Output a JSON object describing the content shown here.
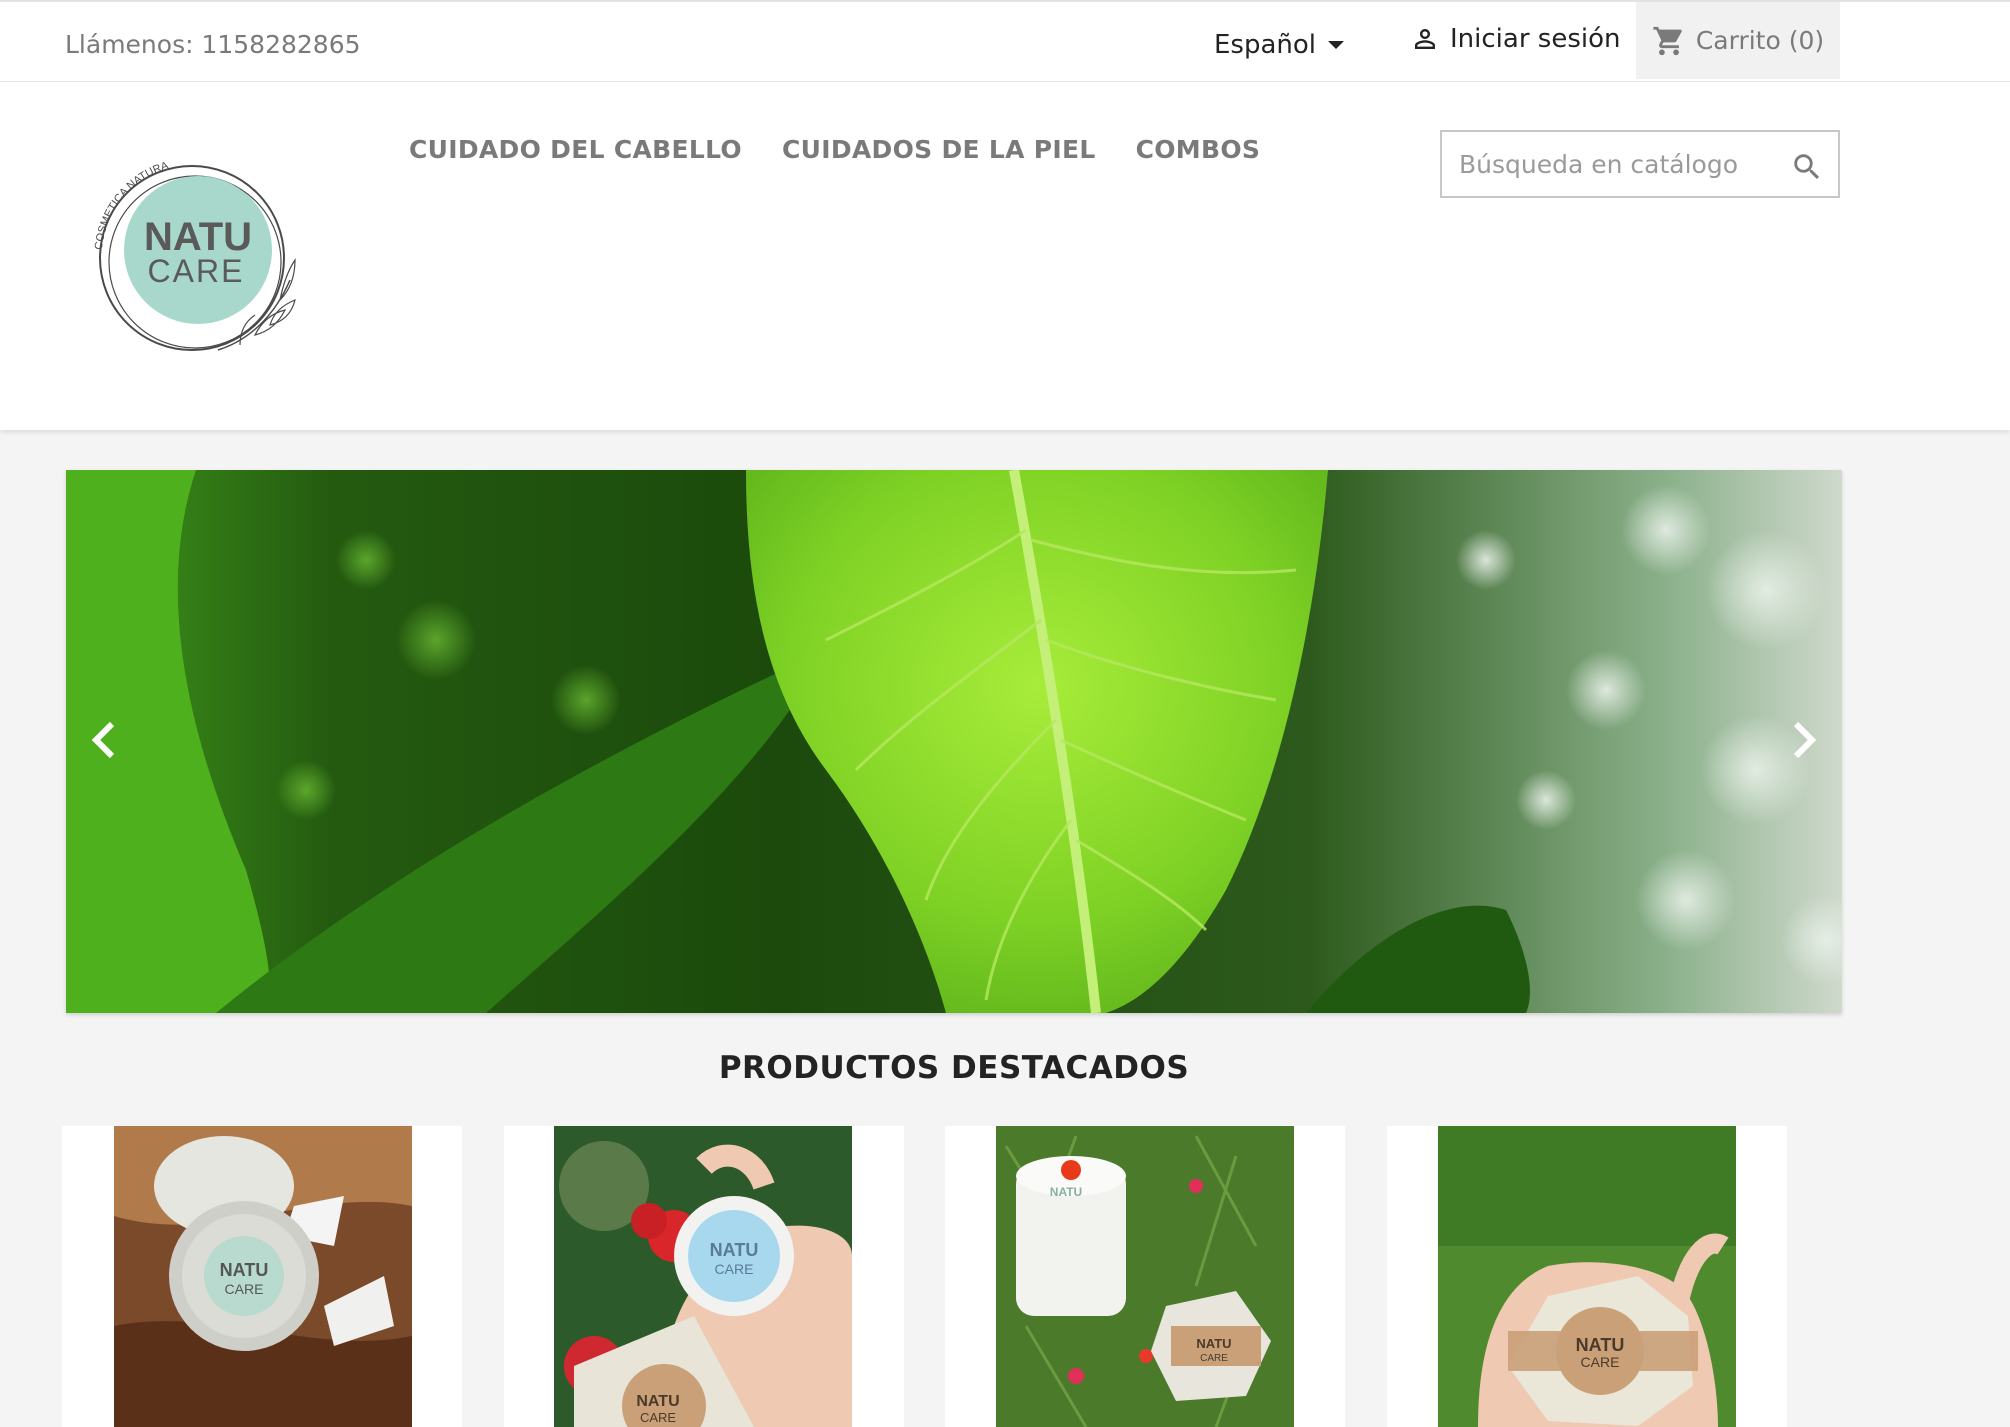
{
  "topbar": {
    "phone": "Llámenos: 1158282865",
    "language": "Español",
    "login_label": "Iniciar sesión",
    "cart_label": "Carrito (0)"
  },
  "brand": {
    "logo_top": "NATU",
    "logo_bottom": "CARE",
    "logo_arc": "COSMETICA NATURAL",
    "accent_color": "#a8d8cc"
  },
  "menu": {
    "items": [
      {
        "label": "CUIDADO DEL CABELLO"
      },
      {
        "label": "CUIDADOS DE LA PIEL"
      },
      {
        "label": "COMBOS"
      }
    ]
  },
  "search": {
    "placeholder": "Búsqueda en catálogo",
    "value": ""
  },
  "carousel": {
    "prev_icon": "chevron-left-icon",
    "next_icon": "chevron-right-icon"
  },
  "featured": {
    "title": "PRODUCTOS DESTACADOS",
    "products": [
      {
        "label_top": "NATU",
        "label_bottom": "CARE"
      },
      {
        "label_top": "NATU",
        "label_bottom": "CARE"
      },
      {
        "label_top": "NATU",
        "label_bottom": "CARE"
      },
      {
        "label_top": "NATU",
        "label_bottom": "CARE"
      }
    ]
  }
}
